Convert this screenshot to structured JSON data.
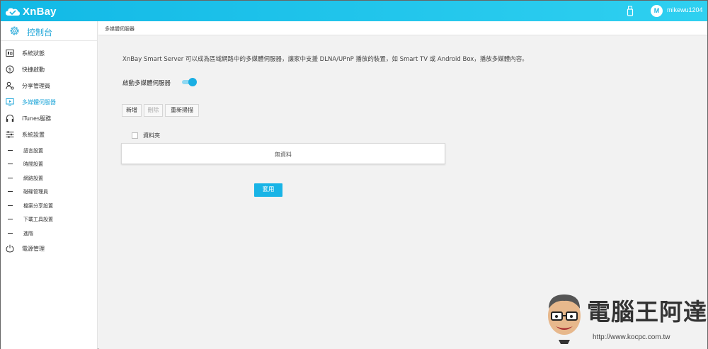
{
  "header": {
    "logo_text": "XnBay",
    "avatar_letter": "M",
    "username": "mikewu1204"
  },
  "sidebar": {
    "dashboard_label": "控制台",
    "items": [
      {
        "label": "系統狀態",
        "icon": "status-icon"
      },
      {
        "label": "快捷啟動",
        "icon": "quick-start-icon"
      },
      {
        "label": "分享管理員",
        "icon": "share-manager-icon"
      },
      {
        "label": "多媒體伺服器",
        "icon": "media-server-icon",
        "active": true
      },
      {
        "label": "iTunes服務",
        "icon": "headphones-icon"
      },
      {
        "label": "系統設置",
        "icon": "sliders-icon"
      }
    ],
    "sub_items": [
      {
        "label": "語言設置"
      },
      {
        "label": "時間設置"
      },
      {
        "label": "網路設置"
      },
      {
        "label": "磁碟管理員"
      },
      {
        "label": "檔案分享設置"
      },
      {
        "label": "下載工具設置"
      },
      {
        "label": "進階"
      }
    ],
    "power_label": "電源管理"
  },
  "main": {
    "breadcrumb": "多媒體伺服器",
    "description": "XnBay Smart Server 可以成為區域網路中的多媒體伺服器，讓家中支援 DLNA/UPnP 播放的裝置，如 Smart TV 或 Android Box，播放多媒體內容。",
    "toggle_label": "啟動多媒體伺服器",
    "toggle_on": true,
    "buttons": {
      "add": "新增",
      "delete": "刪除",
      "rescan": "重新掃描"
    },
    "table_header": "資料夾",
    "empty_text": "無資料",
    "apply_label": "套用"
  },
  "watermark": {
    "title": "電腦王阿達",
    "url": "http://www.kocpc.com.tw"
  },
  "colors": {
    "accent": "#1fb6e3",
    "active_text": "#1fa6d8",
    "content_bg": "#f2f2f2"
  }
}
